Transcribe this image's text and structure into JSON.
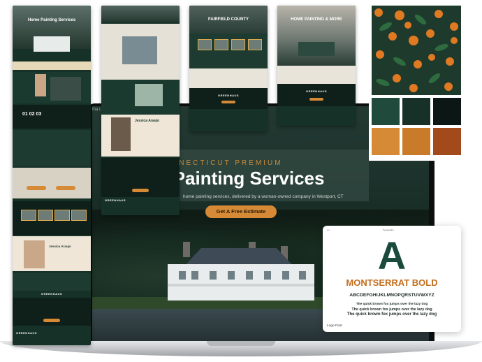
{
  "hero": {
    "kicker": "NNECTICUT PREMIUM",
    "title": "e Painting Services",
    "subtitle": "home painting services, delivered by a woman-owned company in Westport, CT",
    "cta": "Get A Free Estimate",
    "nav_fragment": "tha L"
  },
  "mockups": {
    "tall_left_title": "Home Painting Services",
    "tall_left_person": "Jessica Araujo",
    "mid_person": "Jessica Araujo",
    "county_title": "FAIRFIELD COUNTY",
    "right_title": "HOME PAINTING & MORE",
    "brand": "GREENHAUS"
  },
  "palette": {
    "colors": [
      "#1f4a3c",
      "#173028",
      "#0c1614",
      "#d68a36",
      "#c97b2a",
      "#a24a1b"
    ]
  },
  "typography": {
    "letter": "A",
    "font_name": "MONTSERRAT BOLD",
    "alphabet": "ABCDEFGHIJKLMNOPQRSTUVWXYZ",
    "sample_small": "The quick brown fox jumps over the lazy dog",
    "sample_medium": "The quick brown fox jumps over the lazy dog",
    "sample_large": "The quick brown fox jumps over the lazy dog",
    "footer": "Logo Font",
    "header_left": "e e",
    "header_right": "Typography"
  }
}
